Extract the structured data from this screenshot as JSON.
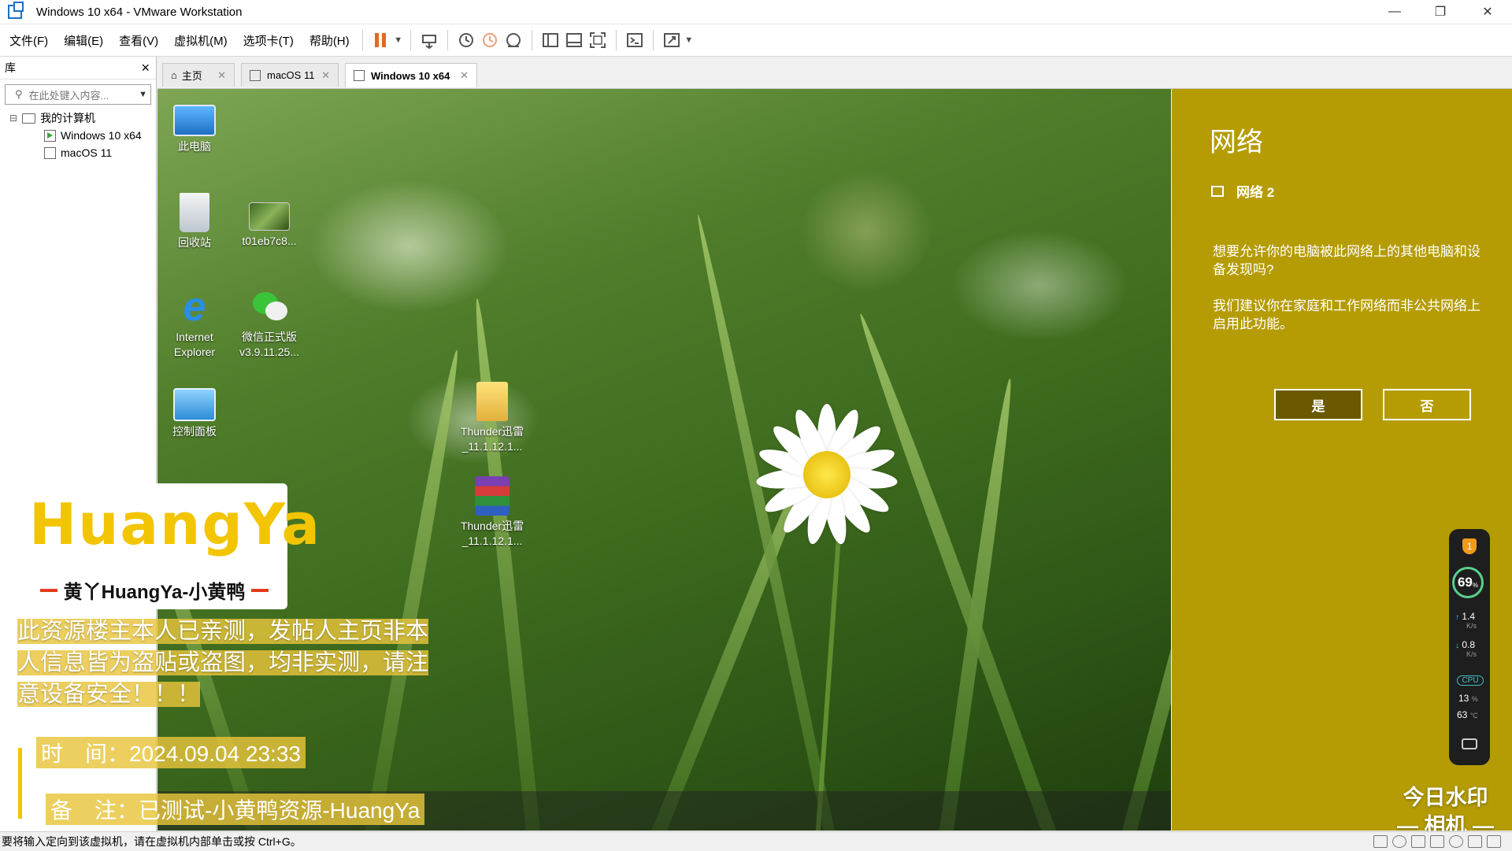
{
  "window": {
    "title": "Windows 10 x64 - VMware Workstation",
    "minimize": "—",
    "restore": "❐",
    "close": "✕"
  },
  "menu": [
    "文件(F)",
    "编辑(E)",
    "查看(V)",
    "虚拟机(M)",
    "选项卡(T)",
    "帮助(H)"
  ],
  "library": {
    "title": "库",
    "close": "×",
    "search_placeholder": "在此处键入内容...",
    "tree": [
      {
        "label": "我的计算机",
        "expander": "⊟"
      },
      {
        "label": "Windows 10 x64"
      },
      {
        "label": "macOS 11"
      }
    ]
  },
  "tabs": [
    {
      "label": "主页"
    },
    {
      "label": "macOS 11"
    },
    {
      "label": "Windows 10 x64"
    }
  ],
  "desktop_icons": [
    {
      "label": "此电脑"
    },
    {
      "label": "回收站"
    },
    {
      "label": "t01eb7c8..."
    },
    {
      "label": "Internet Explorer"
    },
    {
      "label": "微信正式版 v3.9.11.25..."
    },
    {
      "label": "控制面板"
    },
    {
      "label": "Thunder迅雷 _11.1.12.1..."
    },
    {
      "label": "Thunder迅雷 _11.1.12.1..."
    }
  ],
  "network": {
    "title": "网络",
    "network_name": "网络 2",
    "question": "想要允许你的电脑被此网络上的其他电脑和设备发现吗?",
    "advice": "我们建议你在家庭和工作网络而非公共网络上启用此功能。",
    "yes": "是",
    "no": "否"
  },
  "monitor": {
    "badge": "1",
    "percent": "69",
    "percent_unit": "%",
    "up_speed": "1.4",
    "down_speed": "0.8",
    "speed_unit": "K/s",
    "cpu_label": "CPU",
    "cpu_usage": "13",
    "cpu_usage_unit": "%",
    "cpu_temp": "63",
    "cpu_temp_unit": "°C"
  },
  "overlay": {
    "logo_text": "HuangYa",
    "logo_subtitle": "黄丫HuangYa-小黄鸭",
    "notice": "此资源楼主本人已亲测，发帖人主页非本人信息皆为盗贴或盗图，均非实测，请注意设备安全！！！",
    "time": "时　间：2024.09.04 23:33",
    "note": "备　注：已测试-小黄鸭资源-HuangYa",
    "stamp_line1": "今日水印",
    "stamp_line2": "— 相机 —"
  },
  "status": {
    "hint": "要将输入定向到该虚拟机，请在虚拟机内部单击或按 Ctrl+G。"
  },
  "colors": {
    "network_panel": "#b59c04",
    "pause_icon": "#e8661c",
    "logo_yellow": "#f2c500",
    "logo_red": "#e53a1c"
  }
}
